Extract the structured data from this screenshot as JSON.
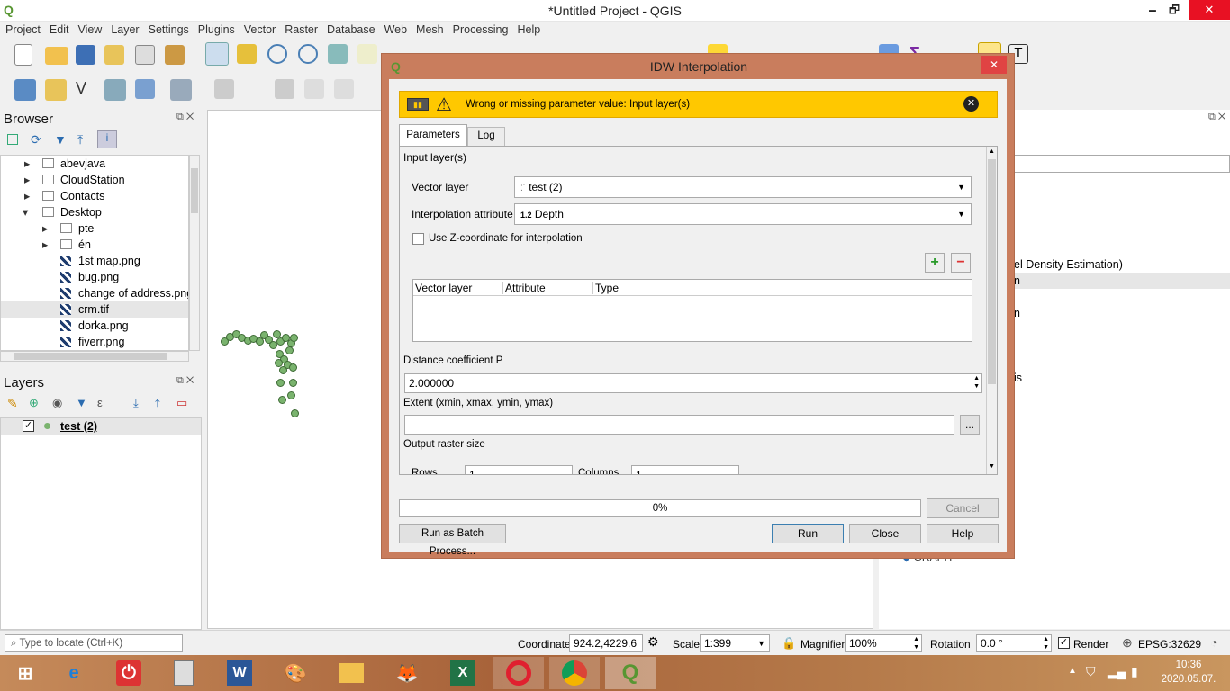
{
  "window": {
    "title": "*Untitled Project - QGIS",
    "minimize": "🗕",
    "restore": "🗗",
    "close": "✕"
  },
  "menu": [
    "Project",
    "Edit",
    "View",
    "Layer",
    "Settings",
    "Plugins",
    "Vector",
    "Raster",
    "Database",
    "Web",
    "Mesh",
    "Processing",
    "Help"
  ],
  "browser": {
    "title": "Browser",
    "items": [
      {
        "label": "abevjava",
        "type": "folder"
      },
      {
        "label": "CloudStation",
        "type": "folder"
      },
      {
        "label": "Contacts",
        "type": "folder"
      },
      {
        "label": "Desktop",
        "type": "folder",
        "expanded": true
      },
      {
        "label": "pte",
        "type": "folder"
      },
      {
        "label": "én",
        "type": "folder"
      },
      {
        "label": "1st map.png",
        "type": "raster"
      },
      {
        "label": "bug.png",
        "type": "raster"
      },
      {
        "label": "change of address.png",
        "type": "raster"
      },
      {
        "label": "crm.tif",
        "type": "raster"
      },
      {
        "label": "dorka.png",
        "type": "raster"
      },
      {
        "label": "fiverr.png",
        "type": "raster"
      }
    ]
  },
  "layers": {
    "title": "Layers",
    "items": [
      {
        "label": "test (2)",
        "checked": true
      }
    ]
  },
  "right_panel": {
    "text1": "el Density Estimation)",
    "text2": "n",
    "text3": "n",
    "text4": "is",
    "text5": "GRAPH"
  },
  "dialog": {
    "title": "IDW Interpolation",
    "warning": "Wrong or missing parameter value: Input layer(s)",
    "tabs": [
      "Parameters",
      "Log"
    ],
    "input_layers_label": "Input layer(s)",
    "vector_layer_label": "Vector layer",
    "vector_layer_value": "test (2)",
    "interp_attr_label": "Interpolation attribute",
    "interp_attr_prefix": "1.2",
    "interp_attr_value": "Depth",
    "use_z_label": "Use Z-coordinate for interpolation",
    "table_headers": [
      "Vector layer",
      "Attribute",
      "Type"
    ],
    "distance_label": "Distance coefficient P",
    "distance_value": "2.000000",
    "extent_label": "Extent (xmin, xmax, ymin, ymax)",
    "extent_btn": "...",
    "output_size_label": "Output raster size",
    "rows_label": "Rows",
    "rows_value": "1",
    "cols_label": "Columns",
    "cols_value": "1",
    "progress": "0%",
    "progress_fraction": 0,
    "cancel": "Cancel",
    "batch": "Run as Batch Process...",
    "run": "Run",
    "close": "Close",
    "help": "Help"
  },
  "status": {
    "locate_placeholder": "Type to locate (Ctrl+K)",
    "coordinate_label": "Coordinate",
    "coordinate_value": "924.2,4229.6",
    "scale_label": "Scale",
    "scale_value": "1:399",
    "magnifier_label": "Magnifier",
    "magnifier_value": "100%",
    "rotation_label": "Rotation",
    "rotation_value": "0.0 °",
    "render_label": "Render",
    "crs": "EPSG:32629"
  },
  "taskbar": {
    "time": "10:36",
    "date": "2020.05.07."
  }
}
